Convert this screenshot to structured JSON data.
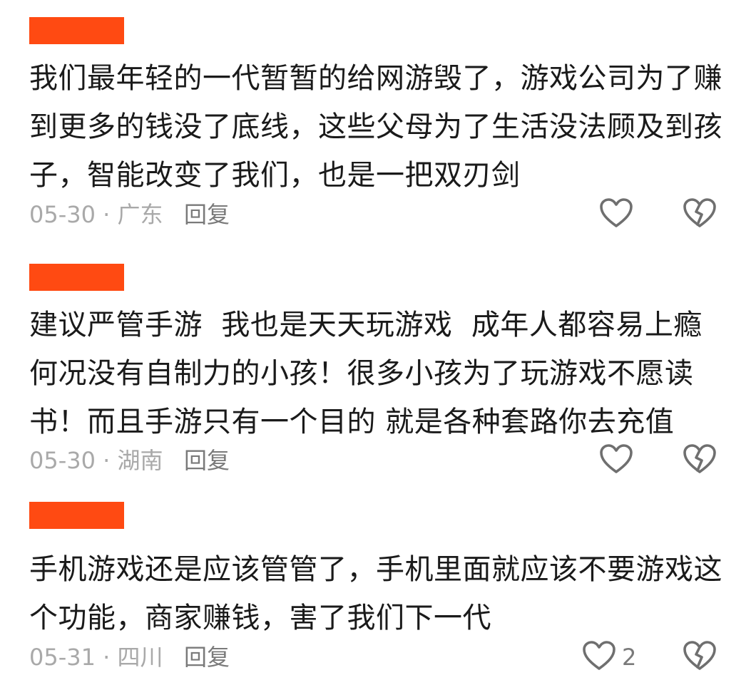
{
  "comments": [
    {
      "text": "我们最年轻的一代暂暂的给网游毁了，游戏公司为了赚到更多的钱没了底线，这些父母为了生活没法顾及到孩子，智能改变了我们，也是一把双刃剑",
      "date": "05-30",
      "location": "广东",
      "reply": "回复",
      "likes": ""
    },
    {
      "text": "建议严管手游  我也是天天玩游戏  成年人都容易上瘾 何况没有自制力的小孩！很多小孩为了玩游戏不愿读书！而且手游只有一个目的 就是各种套路你去充值",
      "date": "05-30",
      "location": "湖南",
      "reply": "回复",
      "likes": ""
    },
    {
      "text": "手机游戏还是应该管管了，手机里面就应该不要游戏这个功能，商家赚钱，害了我们下一代",
      "date": "05-31",
      "location": "四川",
      "reply": "回复",
      "likes": "2"
    }
  ],
  "separator": " · ",
  "icons": {
    "like": "heart-outline-icon",
    "dislike": "broken-heart-icon"
  },
  "colors": {
    "name_bar": "#ff4a12",
    "text": "#1a1a1a",
    "meta": "#a9a9a9",
    "icon": "#6f6f6f"
  }
}
